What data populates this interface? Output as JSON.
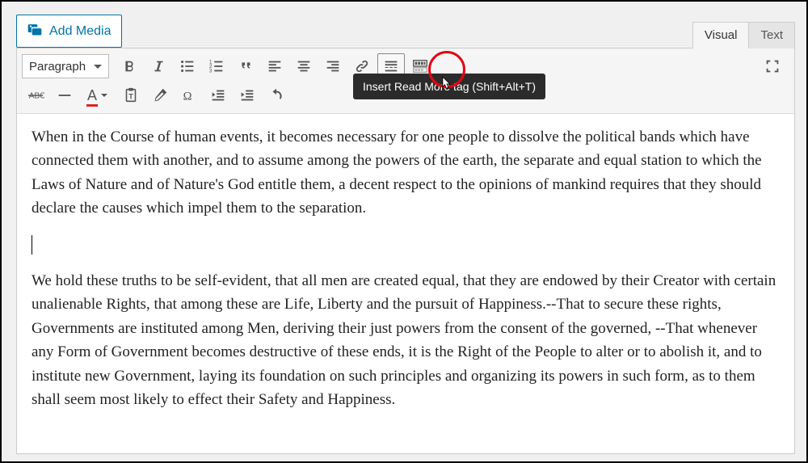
{
  "add_media_label": "Add Media",
  "tabs": {
    "visual": "Visual",
    "text": "Text"
  },
  "format_select": "Paragraph",
  "tooltip_text": "Insert Read More tag (Shift+Alt+T)",
  "content": {
    "p1": "When in the Course of human events, it becomes necessary for one people to dissolve the political bands which have connected them with another, and to assume among the powers of the earth, the separate and equal station to which the Laws of Nature and of Nature's God entitle them, a decent respect to the opinions of mankind requires that they should declare the causes which impel them to the separation.",
    "p2": "We hold these truths to be self-evident, that all men are created equal, that they are endowed by their Creator with certain unalienable Rights, that among these are Life, Liberty and the pursuit of Happiness.--That to secure these rights, Governments are instituted among Men, deriving their just powers from the consent of the governed, --That whenever any Form of Government becomes destructive of these ends, it is the Right of the People to alter or to abolish it, and to institute new Government, laying its foundation on such principles and organizing its powers in such form, as to them shall seem most likely to effect their Safety and Happiness."
  }
}
